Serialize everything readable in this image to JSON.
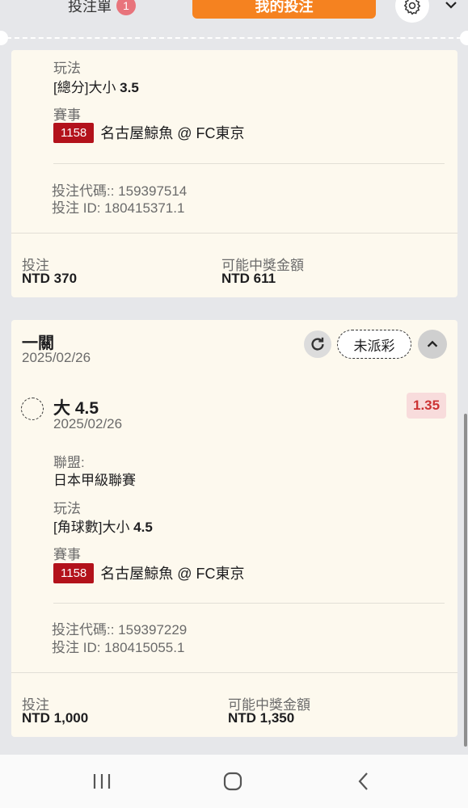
{
  "header": {
    "betslip_label": "投注單",
    "betslip_count": "1",
    "mybets_label": "我的投注"
  },
  "card1": {
    "market_label": "玩法",
    "market_prefix": "[總分]大小 ",
    "market_line": "3.5",
    "event_label": "賽事",
    "match_id": "1158",
    "match_name": "名古屋鯨魚 @ FC東京",
    "bet_code": "投注代碼:: 159397514",
    "bet_id": "投注 ID: 180415371.1",
    "stake_label": "投注",
    "stake_value": "NTD 370",
    "payout_label": "可能中獎金額",
    "payout_value": "NTD 611"
  },
  "card2": {
    "bet_type": "一關",
    "bet_date": "2025/02/26",
    "status": "未派彩",
    "selection": "大 4.5",
    "selection_date": "2025/02/26",
    "odds": "1.35",
    "league_label": "聯盟:",
    "league_name": "日本甲級聯賽",
    "market_label": "玩法",
    "market_prefix": "[角球數]大小 ",
    "market_line": "4.5",
    "event_label": "賽事",
    "match_id": "1158",
    "match_name": "名古屋鯨魚 @ FC東京",
    "bet_code": "投注代碼:: 159397229",
    "bet_id": "投注 ID: 180415055.1",
    "stake_label": "投注",
    "stake_value": "NTD 1,000",
    "payout_label": "可能中獎金額",
    "payout_value": "NTD 1,350"
  },
  "colors": {
    "accent_orange": "#f58220",
    "match_badge_red": "#b3121b",
    "odds_bg": "#f8dcdc",
    "card_bg": "#fdf9ee"
  },
  "icons": [
    "gear-icon",
    "chevron-down-icon",
    "refresh-icon",
    "chevron-up-icon",
    "recent-apps-icon",
    "home-icon",
    "back-icon"
  ]
}
